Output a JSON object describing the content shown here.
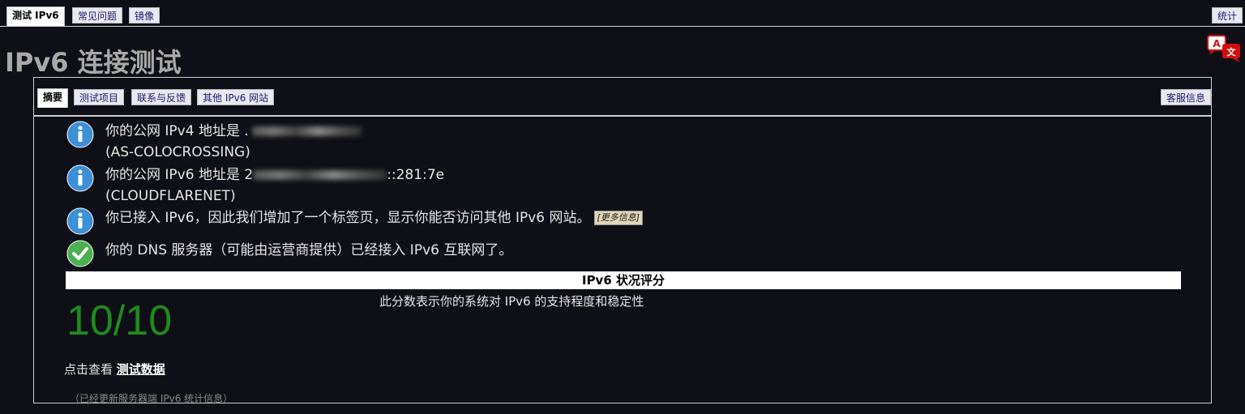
{
  "top_tabs": {
    "test": "测试 IPv6",
    "faq": "常见问题",
    "mirror": "镜像",
    "stats": "统计"
  },
  "page_title": "IPv6 连接测试",
  "language_icon": "translate-icon",
  "sub_tabs": {
    "summary": "摘要",
    "tests": "测试项目",
    "contact": "联系与反馈",
    "other_sites": "其他 IPv6 网站",
    "helpdesk": "客服信息"
  },
  "results": {
    "ipv4_label": "你的公网 IPv4 地址是",
    "ipv4_value": ".",
    "ipv4_asn": "(AS-COLOCROSSING)",
    "ipv6_label": "你的公网 IPv6 地址是",
    "ipv6_value_prefix": "2",
    "ipv6_value_suffix": "::281:7e",
    "ipv6_asn": "(CLOUDFLARENET)",
    "ipv6_tab_note": "你已接入 IPv6，因此我们增加了一个标签页，显示你能否访问其他 IPv6 网站。",
    "more_info": "[更多信息]",
    "dns_note": "你的 DNS 服务器（可能由运营商提供）已经接入 IPv6 互联网了。"
  },
  "score": {
    "header": "IPv6 状况评分",
    "value": "10/10",
    "description": "此分数表示你的系统对 IPv6 的支持程度和稳定性"
  },
  "test_data": {
    "prefix": "点击查看",
    "link": "测试数据"
  },
  "footnote": "（已经更新服务器端 IPv6 统计信息）",
  "colors": {
    "background": "#0f0f17",
    "score_green": "#1e8b1e",
    "info_blue": "#3d8fd6",
    "check_green": "#4caf50"
  }
}
